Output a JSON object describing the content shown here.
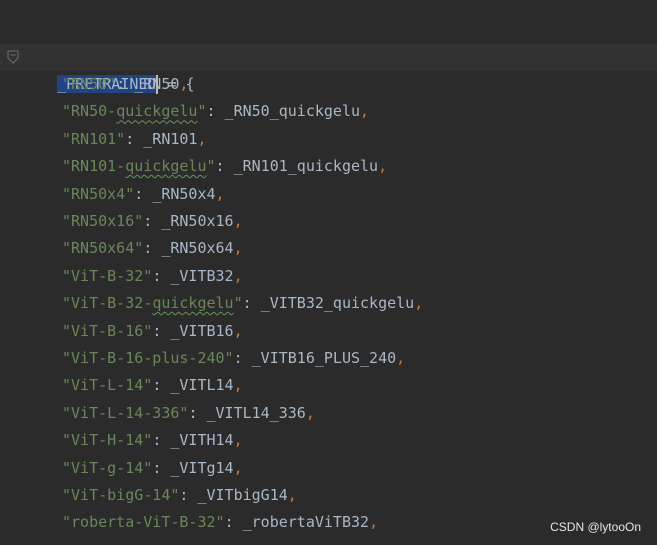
{
  "editor": {
    "declaration": {
      "name": "_PRETRAINED",
      "operator": " = {"
    },
    "entries": [
      {
        "key": "\"RN50\"",
        "sep": ": ",
        "value": "_RN50",
        "comma": ","
      },
      {
        "key_pre": "\"RN50-",
        "key_typo": "quickgelu",
        "key_post": "\"",
        "sep": ": ",
        "value": "_RN50_quickgelu",
        "comma": ","
      },
      {
        "key": "\"RN101\"",
        "sep": ": ",
        "value": "_RN101",
        "comma": ","
      },
      {
        "key_pre": "\"RN101-",
        "key_typo": "quickgelu",
        "key_post": "\"",
        "sep": ": ",
        "value": "_RN101_quickgelu",
        "comma": ","
      },
      {
        "key": "\"RN50x4\"",
        "sep": ": ",
        "value": "_RN50x4",
        "comma": ","
      },
      {
        "key": "\"RN50x16\"",
        "sep": ": ",
        "value": "_RN50x16",
        "comma": ","
      },
      {
        "key": "\"RN50x64\"",
        "sep": ": ",
        "value": "_RN50x64",
        "comma": ","
      },
      {
        "key": "\"ViT-B-32\"",
        "sep": ": ",
        "value": "_VITB32",
        "comma": ","
      },
      {
        "key_pre": "\"ViT-B-32-",
        "key_typo": "quickgelu",
        "key_post": "\"",
        "sep": ": ",
        "value": "_VITB32_quickgelu",
        "comma": ","
      },
      {
        "key": "\"ViT-B-16\"",
        "sep": ": ",
        "value": "_VITB16",
        "comma": ","
      },
      {
        "key": "\"ViT-B-16-plus-240\"",
        "sep": ": ",
        "value": "_VITB16_PLUS_240",
        "comma": ","
      },
      {
        "key": "\"ViT-L-14\"",
        "sep": ": ",
        "value": "_VITL14",
        "comma": ","
      },
      {
        "key": "\"ViT-L-14-336\"",
        "sep": ": ",
        "value": "_VITL14_336",
        "comma": ","
      },
      {
        "key": "\"ViT-H-14\"",
        "sep": ": ",
        "value": "_VITH14",
        "comma": ","
      },
      {
        "key": "\"ViT-g-14\"",
        "sep": ": ",
        "value": "_VITg14",
        "comma": ","
      },
      {
        "key": "\"ViT-bigG-14\"",
        "sep": ": ",
        "value": "_VITbigG14",
        "comma": ","
      },
      {
        "key": "\"roberta-ViT-B-32\"",
        "sep": ": ",
        "value": "_robertaViTB32",
        "comma": ","
      }
    ]
  },
  "colors": {
    "background": "#2b2b2b",
    "current_line": "#323232",
    "selection": "#214283",
    "string": "#6a8759",
    "identifier": "#a9b7c6",
    "comma": "#cc7832"
  },
  "icons": {
    "fold_marker": "fold-marker-icon"
  },
  "watermark": {
    "text": "CSDN @lytooOn"
  }
}
